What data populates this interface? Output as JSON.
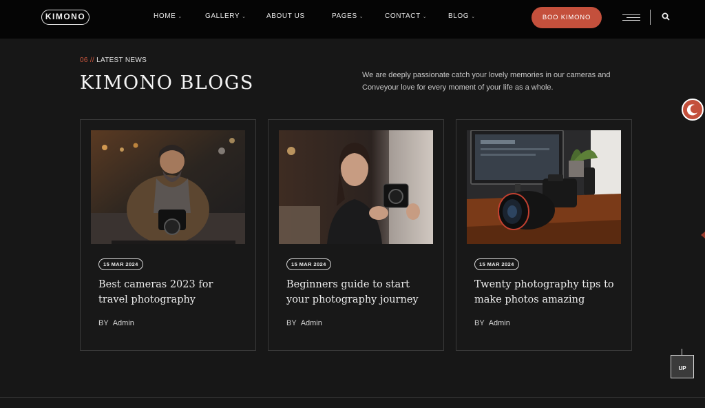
{
  "header": {
    "logo": "KIMONO",
    "nav": [
      {
        "label": "HOME",
        "dropdown": true
      },
      {
        "label": "GALLERY",
        "dropdown": true
      },
      {
        "label": "ABOUT US",
        "dropdown": false
      },
      {
        "label": "PAGES",
        "dropdown": true
      },
      {
        "label": "CONTACT",
        "dropdown": true
      },
      {
        "label": "BLOG",
        "dropdown": true
      }
    ],
    "cta_label": "BOO KIMONO",
    "icons": [
      "menu-icon",
      "search-icon"
    ]
  },
  "section": {
    "number": "06",
    "separator": "//",
    "eyebrow": "LATEST NEWS",
    "title": "KIMONO BLOGS",
    "intro": "We are deeply passionate catch your lovely memories in our cameras and Conveyour love for every moment of your life as a whole."
  },
  "cards": [
    {
      "date": "15 MAR 2024",
      "title": "Best cameras 2023 for travel photography",
      "by": "BY",
      "author": "Admin"
    },
    {
      "date": "15 MAR 2024",
      "title": "Beginners guide to start your photography journey",
      "by": "BY",
      "author": "Admin"
    },
    {
      "date": "15 MAR 2024",
      "title": "Twenty photography tips to make photos amazing",
      "by": "BY",
      "author": "Admin"
    }
  ],
  "widgets": {
    "up_label": "UP",
    "theme_toggle_icon": "moon-icon"
  },
  "colors": {
    "background": "#171717",
    "header": "#050505",
    "accent": "#c4503c"
  }
}
